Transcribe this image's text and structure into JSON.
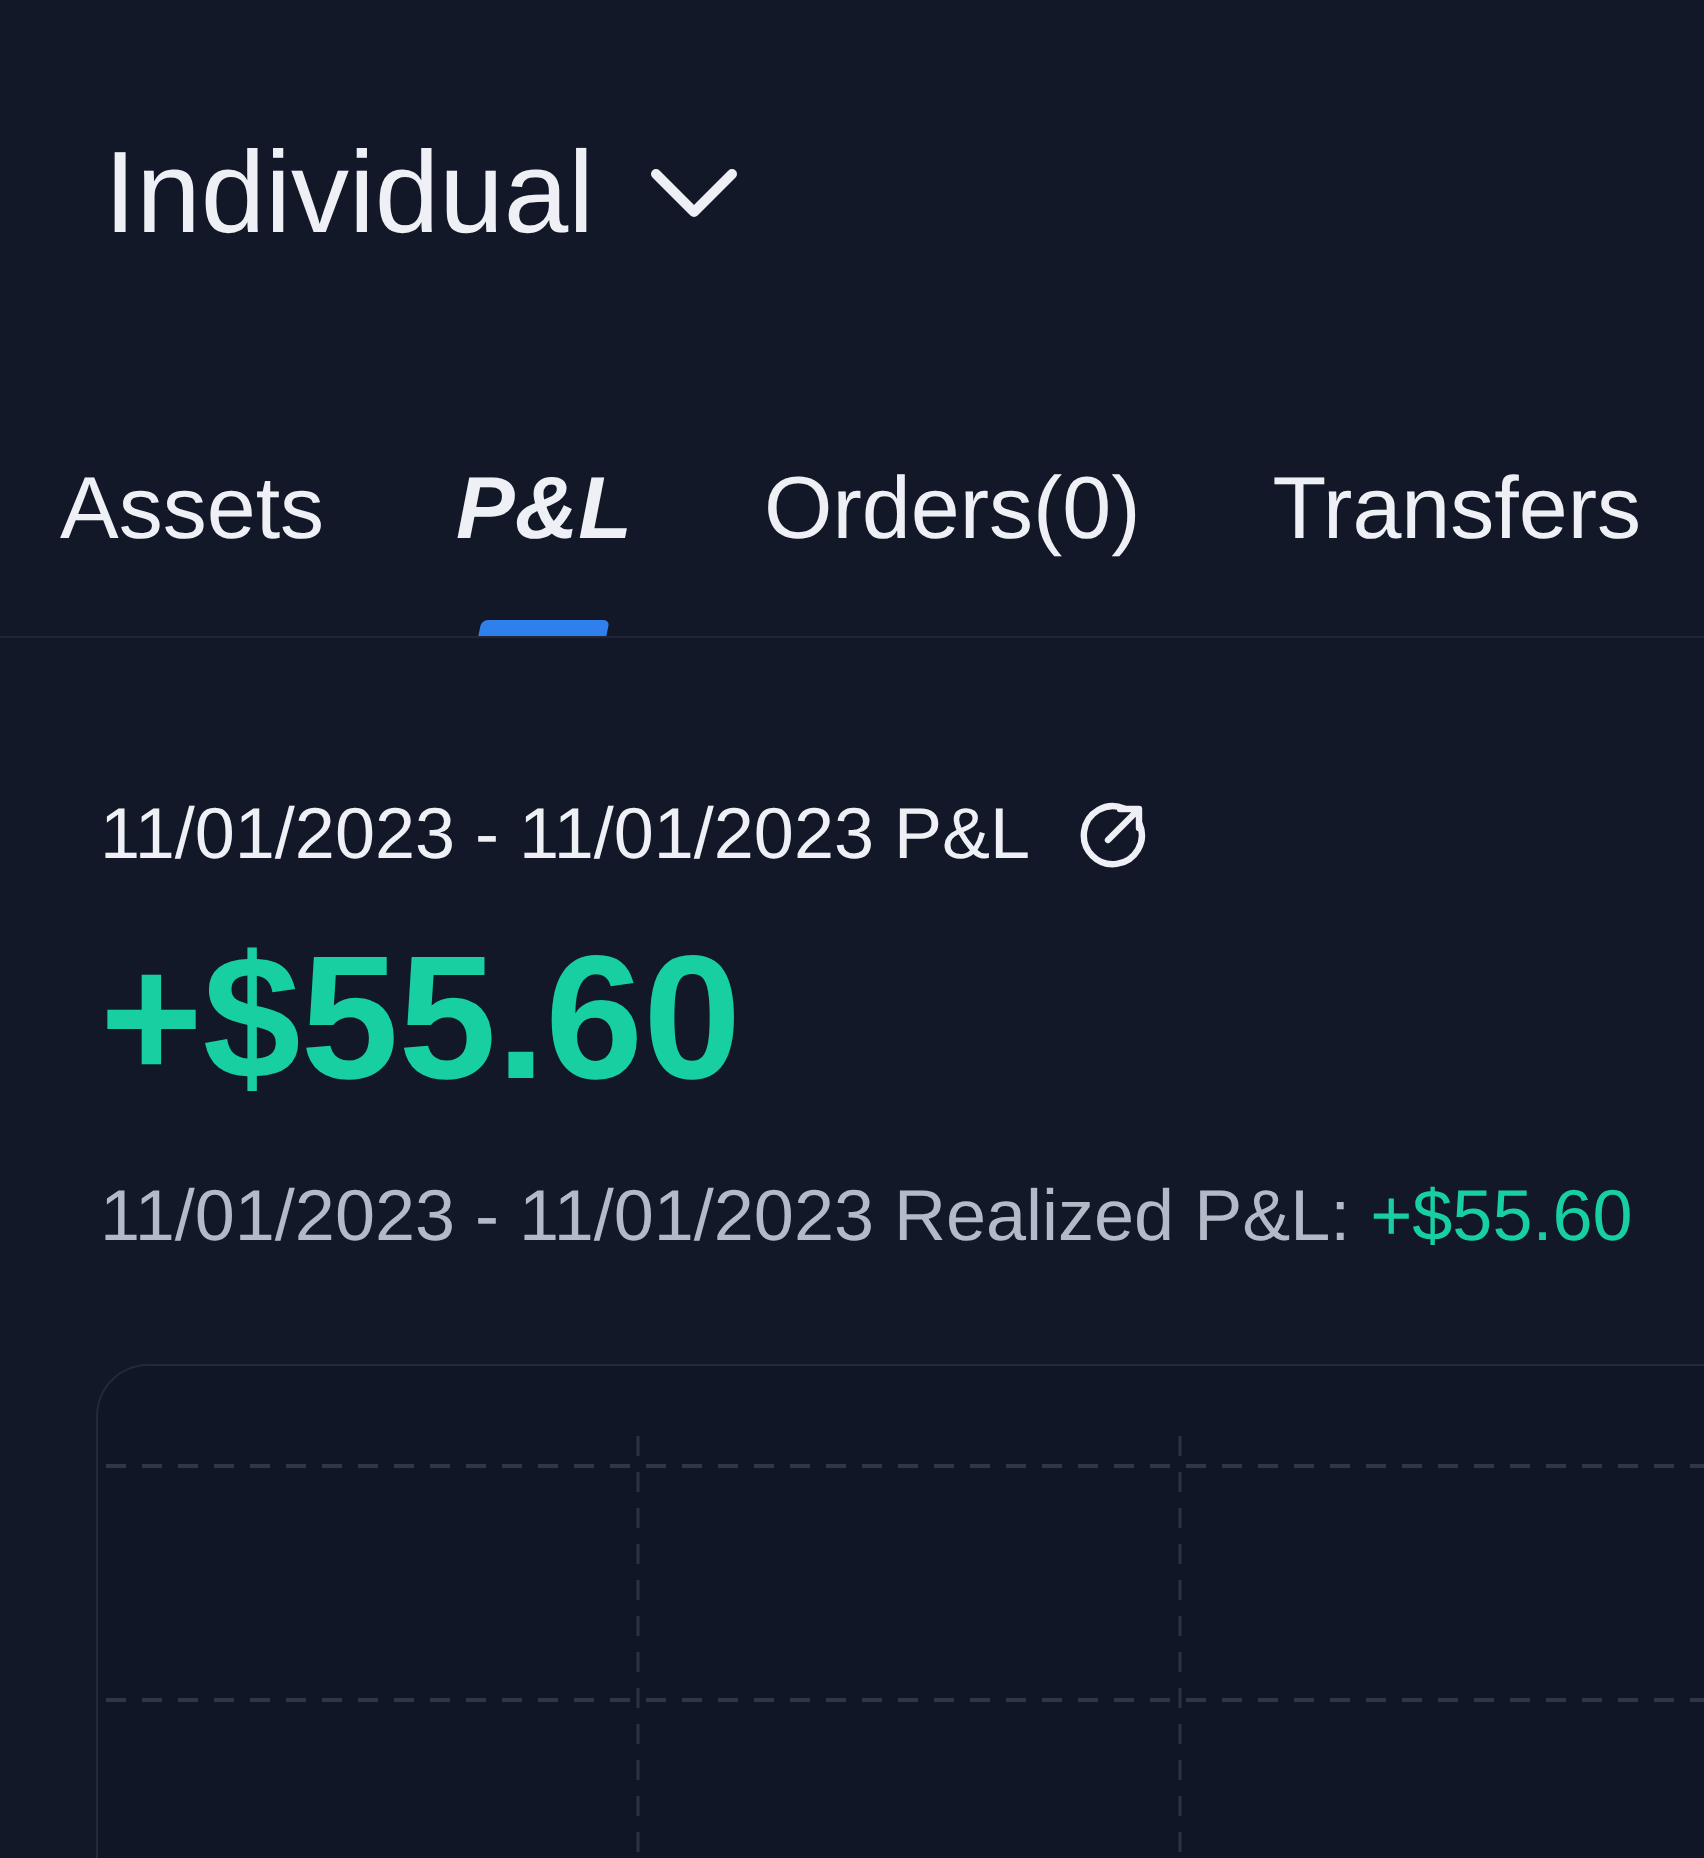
{
  "account_selector": {
    "label": "Individual"
  },
  "tabs": [
    {
      "label": "Assets",
      "selected": false
    },
    {
      "label": "P&L",
      "selected": true
    },
    {
      "label": "Orders(0)",
      "selected": false
    },
    {
      "label": "Transfers",
      "selected": false
    }
  ],
  "pnl": {
    "period_title": "11/01/2023 - 11/01/2023 P&L",
    "amount": "+$55.60",
    "realized_label": "11/01/2023 - 11/01/2023 Realized P&L:",
    "realized_value": "+$55.60"
  }
}
